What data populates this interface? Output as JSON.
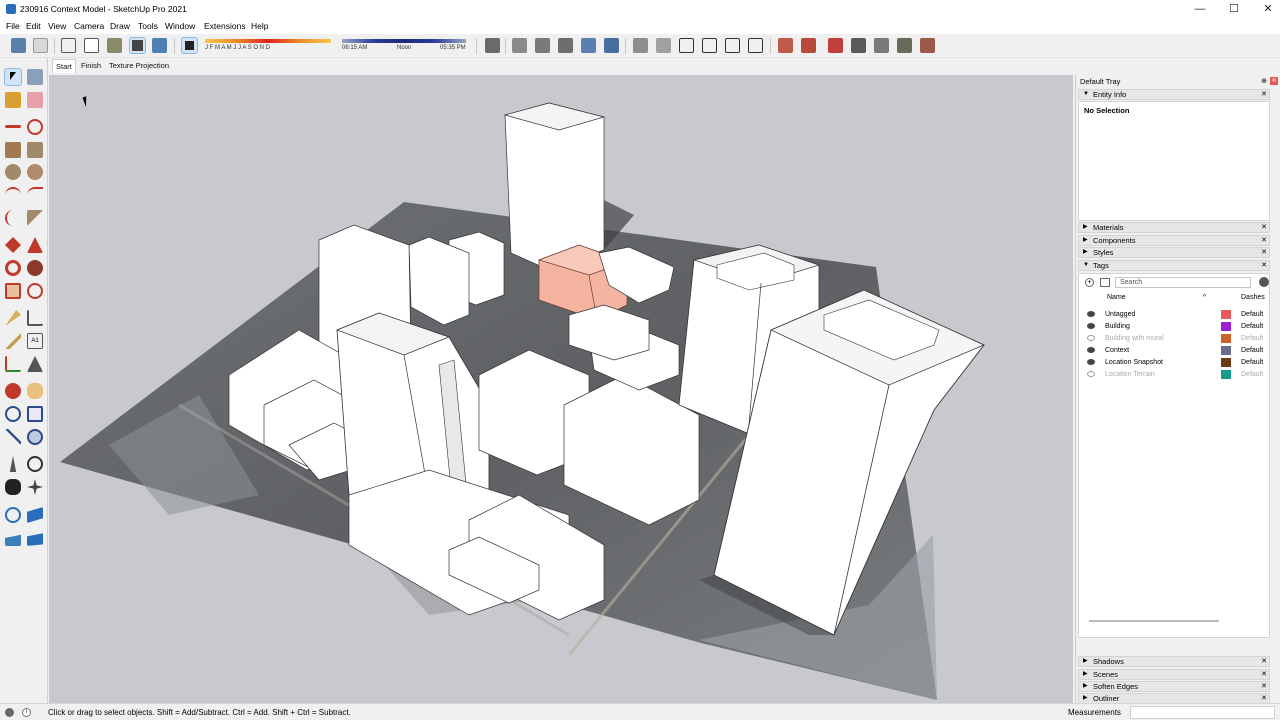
{
  "window": {
    "title": "230916 Context Model - SketchUp Pro 2021",
    "min_label": "—",
    "max_label": "☐",
    "close_label": "✕"
  },
  "menu": [
    "File",
    "Edit",
    "View",
    "Camera",
    "Draw",
    "Tools",
    "Window",
    "Extensions",
    "Help"
  ],
  "toolbar": {
    "months": "J  F  M  A  M  J  J  A  S  O  N  D",
    "time_start": "06:15 AM",
    "time_noon": "Noon",
    "time_end": "05:35 PM"
  },
  "scene_tabs": [
    "Start",
    "Finish",
    "Texture Projection"
  ],
  "tray": {
    "title": "Default Tray",
    "pin": "⊕",
    "entity_info": {
      "label": "Entity Info",
      "selection": "No Selection"
    },
    "panels_collapsed_top": [
      "Materials",
      "Components",
      "Styles"
    ],
    "tags": {
      "label": "Tags",
      "search_placeholder": "Search",
      "col_name": "Name",
      "col_dashes": "Dashes",
      "rows": [
        {
          "name": "Untagged",
          "visible": true,
          "color": "#e85a5a",
          "dash": "Default"
        },
        {
          "name": "Building",
          "visible": true,
          "color": "#9a1fd6",
          "dash": "Default"
        },
        {
          "name": "Building with mural",
          "visible": false,
          "color": "#d0602a",
          "dash": "Default"
        },
        {
          "name": "Context",
          "visible": true,
          "color": "#6a6e8e",
          "dash": "Default"
        },
        {
          "name": "Location Snapshot",
          "visible": true,
          "color": "#6b3c12",
          "dash": "Default"
        },
        {
          "name": "Location Terrain",
          "visible": false,
          "color": "#1a9a8a",
          "dash": "Default"
        }
      ]
    },
    "panels_collapsed_bottom": [
      "Shadows",
      "Scenes",
      "Soften Edges",
      "Outliner"
    ]
  },
  "status": {
    "hint": "Click or drag to select objects. Shift = Add/Subtract. Ctrl = Add. Shift + Ctrl = Subtract.",
    "measurements_label": "Measurements",
    "measurements_value": ""
  },
  "colors": {
    "highlight_building": "#f4b4a0",
    "viewport_bg": "#c8c9ce",
    "terrain": "#6a6f73"
  }
}
